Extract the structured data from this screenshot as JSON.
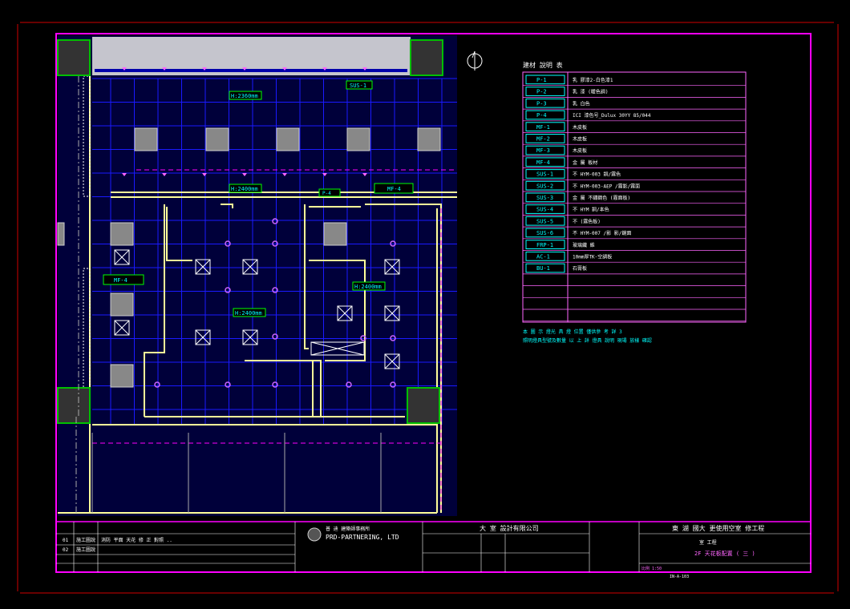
{
  "legend": {
    "title": "建材 說明 表",
    "items": [
      {
        "code": "P-1",
        "desc": "乳 膠漆2-白色漆1"
      },
      {
        "code": "P-2",
        "desc": "乳 漆 (暖色調)"
      },
      {
        "code": "P-3",
        "desc": "乳 白色"
      },
      {
        "code": "P-4",
        "desc": "ICI 漆色号_Dulux 30YY 85/044"
      },
      {
        "code": "MF-1",
        "desc": "木皮板"
      },
      {
        "code": "MF-2",
        "desc": "木皮板"
      },
      {
        "code": "MF-3",
        "desc": "木皮板"
      },
      {
        "code": "MF-4",
        "desc": "金 屬 板材"
      },
      {
        "code": "SUS-1",
        "desc": "不 HYM-003 銅/霧色"
      },
      {
        "code": "SUS-2",
        "desc": "不 HYM-003-AEP /霧影/霧面"
      },
      {
        "code": "SUS-3",
        "desc": "金 屬 不鏽鋼色 (霧面板)"
      },
      {
        "code": "SUS-4",
        "desc": "不 HYM 銅/本色"
      },
      {
        "code": "SUS-5",
        "desc": "不 (霧色板)"
      },
      {
        "code": "SUS-6",
        "desc": "不 HYM-007 /影 影/鏡面"
      },
      {
        "code": "FRP-1",
        "desc": "玻璃纖 維"
      },
      {
        "code": "AC-1",
        "desc": "10mm厚TK-空調板"
      },
      {
        "code": "BU-1",
        "desc": "石膏板"
      }
    ],
    "notes": [
      "本 圖 示 燈光 具 燈 位置 僅供參 考 詳 3",
      "照明燈具型號及數量 以 上 詳 燈具 說明 現場 放樣 確認"
    ]
  },
  "plan_labels": {
    "ceiling_1": "H:2360mm",
    "ceiling_2": "H:2400mm",
    "ceiling_3": "H:2400mm",
    "ceiling_4": "H:2400mm",
    "sus_tag": "SUS-1",
    "mf_tag_1": "MF-4",
    "mf_tag_2": "MF-4",
    "small_tag": "P-4"
  },
  "title_block": {
    "company_cn": "普 迪 建築師事務所",
    "company_en": "PRD-PARTNERING, LTD",
    "client": "大 室 設計有限公司",
    "project": "東 湖 國大 更使用空室 修工程",
    "sub_project": "室 工程",
    "drawing_title": "2F 天花板配置 ( 三 )",
    "rev1_no": "01",
    "rev1_text": "施工圖說",
    "rev1_desc": "消防 平面 天花 修 正 對照 ..",
    "rev2_no": "02",
    "rev2_text": "施工圖說",
    "drawing_no": "IN-A-103",
    "scale_label": "比例 1:50"
  },
  "colors": {
    "background": "#000000",
    "frame": "#ff00ff",
    "grid": "#0000ff",
    "wall": "#ffff99",
    "text": "#ffffff",
    "tag": "#00ffff",
    "column": "#00c000"
  }
}
